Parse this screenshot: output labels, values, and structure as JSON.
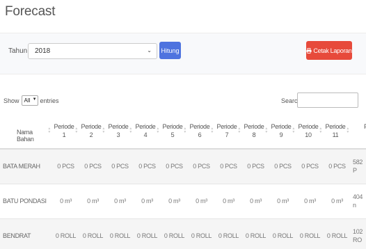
{
  "page": {
    "title": "Forecast"
  },
  "filter": {
    "year_label": "Tahun",
    "year_value": "2018",
    "hitung_label": "Hitung",
    "print_label": "Cetak Laporan"
  },
  "table_controls": {
    "show_label": "Show",
    "entries_value": "All",
    "entries_label": "entries",
    "search_label": "Search:"
  },
  "table": {
    "header_name": "Nama Bahan",
    "periods": [
      [
        "Periode",
        "1"
      ],
      [
        "Periode",
        "2"
      ],
      [
        "Periode",
        "3"
      ],
      [
        "Periode",
        "4"
      ],
      [
        "Periode",
        "5"
      ],
      [
        "Periode",
        "6"
      ],
      [
        "Periode",
        "7"
      ],
      [
        "Periode",
        "8"
      ],
      [
        "Periode",
        "9"
      ],
      [
        "Periode",
        "10"
      ],
      [
        "Periode",
        "11"
      ],
      [
        "Per",
        "1"
      ]
    ],
    "rows": [
      {
        "name": "BATA MERAH",
        "unit_value": "0 PCS",
        "last": [
          "582",
          "P"
        ]
      },
      {
        "name": "BATU PONDASI",
        "unit_value": "0 m³",
        "last": [
          "404",
          "n"
        ]
      },
      {
        "name": "BENDRAT",
        "unit_value": "0 ROLL",
        "last": [
          "102",
          "RO"
        ]
      }
    ]
  }
}
